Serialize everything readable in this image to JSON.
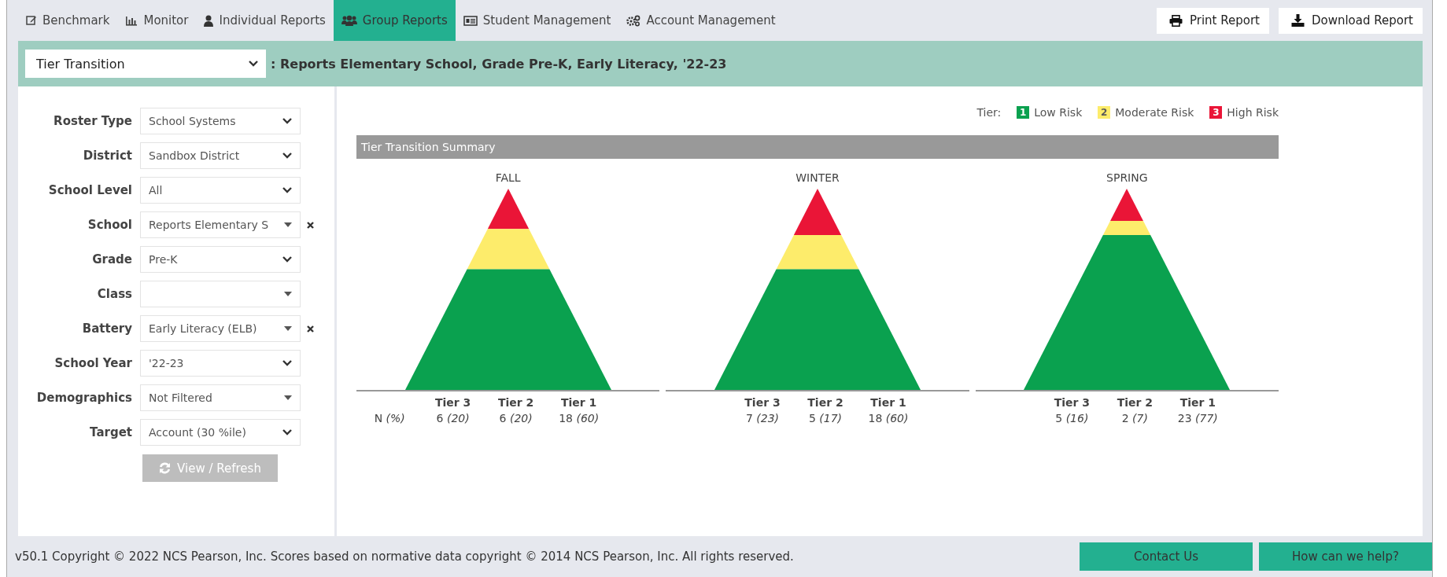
{
  "nav": {
    "tabs": [
      {
        "label": "Benchmark",
        "selected": false
      },
      {
        "label": "Monitor",
        "selected": false
      },
      {
        "label": "Individual Reports",
        "selected": false
      },
      {
        "label": "Group Reports",
        "selected": true
      },
      {
        "label": "Student Management",
        "selected": false
      },
      {
        "label": "Account Management",
        "selected": false
      }
    ],
    "buttons": [
      {
        "label": "Print Report",
        "kind": "print"
      },
      {
        "label": "Download Report",
        "kind": "download"
      }
    ]
  },
  "report_bar": {
    "report_select": "Tier Transition",
    "subtitle": ": Reports Elementary School, Grade Pre-K, Early Literacy, '22-23"
  },
  "filters": [
    {
      "label": "Roster Type",
      "value": "School Systems",
      "kind": "chevron",
      "clearable": false
    },
    {
      "label": "District",
      "value": "Sandbox District",
      "kind": "chevron",
      "clearable": false
    },
    {
      "label": "School Level",
      "value": "All",
      "kind": "chevron",
      "clearable": false
    },
    {
      "label": "School",
      "value": "Reports Elementary S",
      "kind": "triangle",
      "clearable": true
    },
    {
      "label": "Grade",
      "value": "Pre-K",
      "kind": "chevron",
      "clearable": false
    },
    {
      "label": "Class",
      "kind": "triangle",
      "clearable": false
    },
    {
      "label": "Battery",
      "value": "Early Literacy (ELB)",
      "kind": "triangle",
      "clearable": true
    },
    {
      "label": "School Year",
      "value": "'22-23",
      "kind": "chevron",
      "clearable": false
    },
    {
      "label": "Demographics",
      "value": "Not Filtered",
      "kind": "triangle",
      "clearable": false
    },
    {
      "label": "Target",
      "value": "Account (30 %ile)",
      "kind": "chevron",
      "clearable": false
    }
  ],
  "view_button": {
    "label": "View / Refresh",
    "disabled": true
  },
  "legend": {
    "label": "Tier:",
    "items": [
      {
        "number": "1",
        "label": "Low Risk",
        "color": "#0aa14f"
      },
      {
        "number": "2",
        "label": "Moderate Risk",
        "color": "#fdec6b"
      },
      {
        "number": "3",
        "label": "High Risk",
        "color": "#ea1537"
      }
    ]
  },
  "summary": {
    "title": "Tier Transition Summary",
    "seasons": [
      {
        "label": "FALL",
        "table": {
          "row_label": "N *(%)*",
          "columns": [
            "Tier 3",
            "Tier 2",
            "Tier 1"
          ],
          "cells": [
            {
              "count": "6",
              "percent": "(20)"
            },
            {
              "count": "6",
              "percent": "(20)"
            },
            {
              "count": "18",
              "percent": "(60)"
            }
          ]
        }
      },
      {
        "label": "WINTER",
        "table": {
          "columns": [
            "Tier 3",
            "Tier 2",
            "Tier 1"
          ],
          "cells": [
            {
              "count": "7",
              "percent": "(23)"
            },
            {
              "count": "5",
              "percent": "(17)"
            },
            {
              "count": "18",
              "percent": "(60)"
            }
          ]
        }
      },
      {
        "label": "SPRING",
        "table": {
          "columns": [
            "Tier 3",
            "Tier 2",
            "Tier 1"
          ],
          "cells": [
            {
              "count": "5",
              "percent": "(16)"
            },
            {
              "count": "2",
              "percent": "(7)"
            },
            {
              "count": "23",
              "percent": "(77)"
            }
          ]
        }
      }
    ]
  },
  "footer": {
    "copyright": "v50.1 Copyright © 2022 NCS Pearson, Inc. Scores based on normative data copyright © 2014 NCS Pearson, Inc. All rights reserved.",
    "buttons": [
      "Contact Us",
      "How can we help?"
    ]
  }
}
